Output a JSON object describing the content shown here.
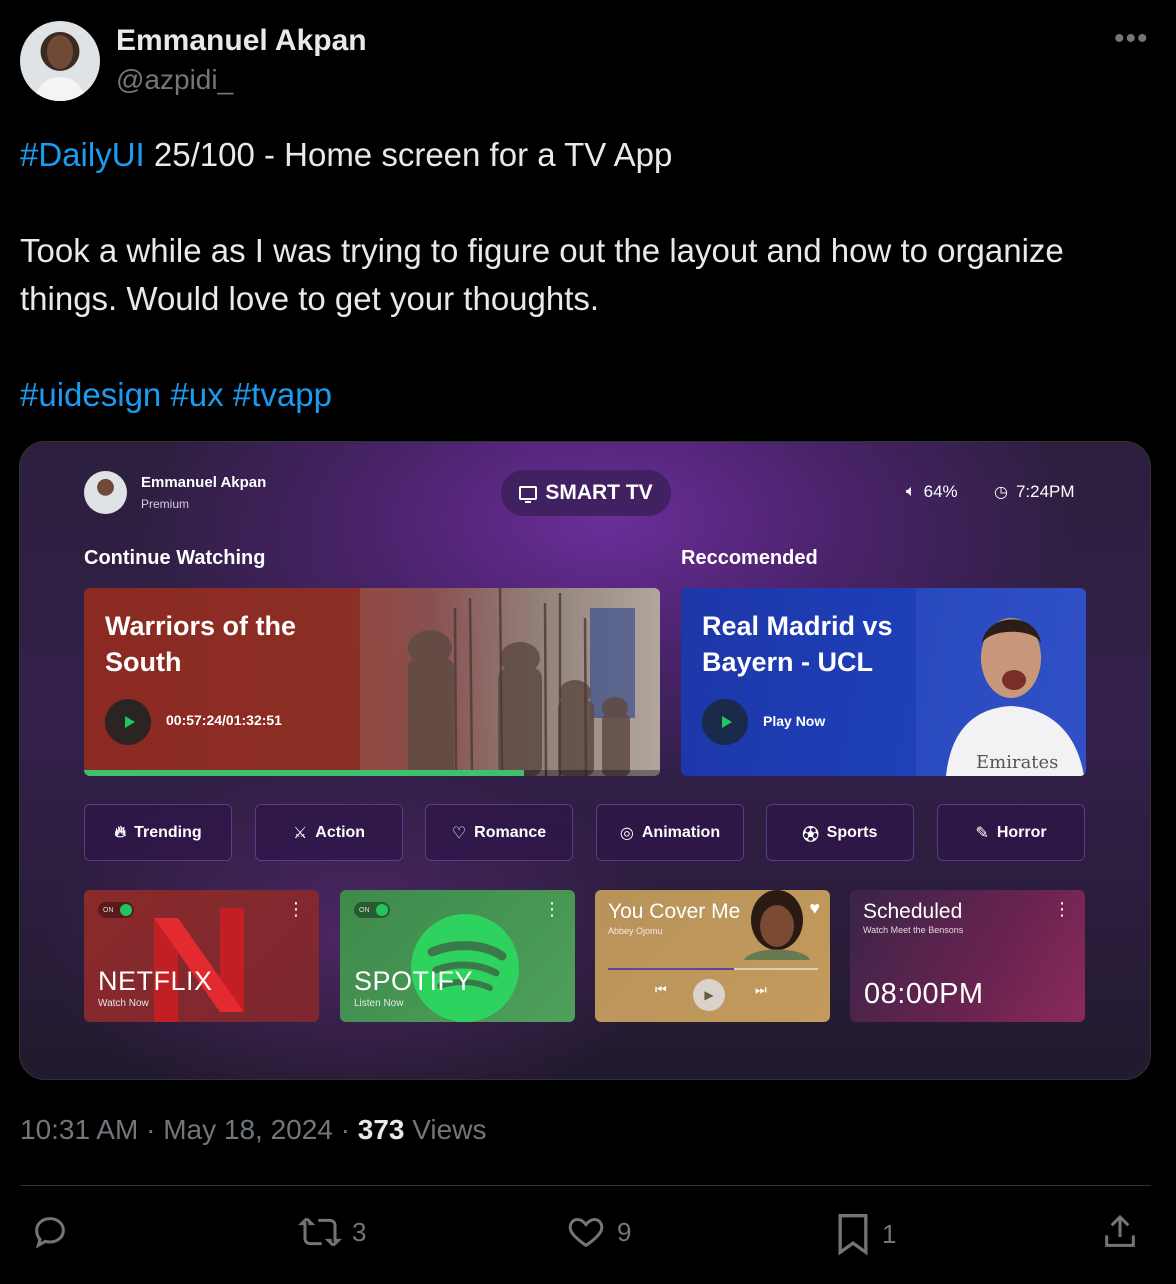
{
  "tweet": {
    "author_name": "Emmanuel Akpan",
    "author_handle": "@azpidi_",
    "more_label": "•••",
    "line1_tag": "#DailyUI",
    "line1_text": " 25/100 - Home screen for a TV App",
    "line2_text": "Took a while as I was trying to figure out the layout and how to organize things. Would love to get your thoughts.",
    "tags": [
      "#uidesign",
      "#ux",
      "#tvapp"
    ],
    "time": "10:31 AM",
    "date": "May 18, 2024",
    "views_count": "373",
    "views_label": "Views",
    "retweets": "3",
    "likes": "9",
    "bookmarks": "1"
  },
  "tv_app": {
    "user_name": "Emmanuel Akpan",
    "user_tier": "Premium",
    "brand": "SMART TV",
    "volume": "64%",
    "clock": "7:24PM",
    "continue_title": "Continue Watching",
    "recommended_title": "Reccomended",
    "continue_card": {
      "title": "Warriors of the South",
      "timestamp": "00:57:24/01:32:51",
      "progress": 0.764
    },
    "recommended_card": {
      "title": "Real Madrid vs Bayern - UCL",
      "action": "Play Now"
    },
    "genres": [
      {
        "label": "Trending",
        "icon": "flame-icon"
      },
      {
        "label": "Action",
        "icon": "swords-icon"
      },
      {
        "label": "Romance",
        "icon": "heart-icon"
      },
      {
        "label": "Animation",
        "icon": "animation-icon"
      },
      {
        "label": "Sports",
        "icon": "soccer-ball-icon"
      },
      {
        "label": "Horror",
        "icon": "knife-icon"
      }
    ],
    "tiles": {
      "netflix": {
        "toggle": "ON",
        "name": "NETFLIX",
        "sub": "Watch Now"
      },
      "spotify": {
        "toggle": "ON",
        "name": "SPOTIFY",
        "sub": "Listen Now"
      },
      "music": {
        "song": "You Cover Me",
        "artist": "Abbey Ojomu",
        "progress": 0.6
      },
      "scheduled": {
        "title": "Scheduled",
        "sub": "Watch Meet the Bensons",
        "time": "08:00PM"
      }
    }
  },
  "colors": {
    "accent_blue": "#1d9bf0",
    "progress_green": "#3ec16b",
    "muted": "#71767b"
  }
}
